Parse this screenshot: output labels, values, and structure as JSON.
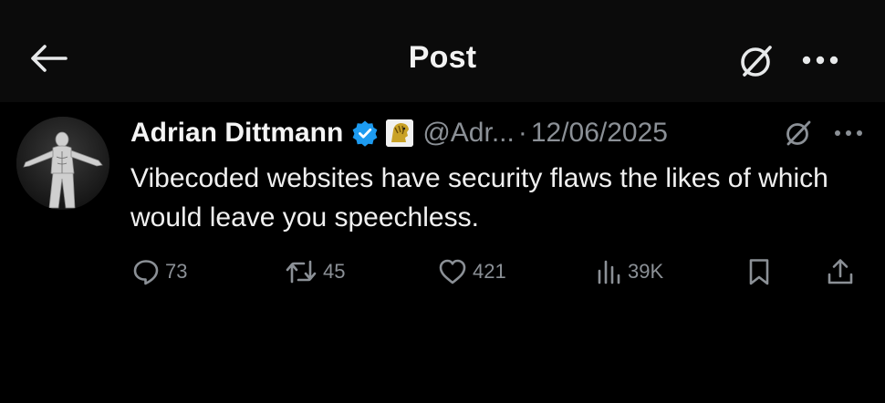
{
  "header": {
    "title": "Post",
    "back_icon": "arrow-left-icon",
    "grok_icon": "grok-icon",
    "more_icon": "more-horizontal-icon"
  },
  "tweet": {
    "display_name": "Adrian Dittmann",
    "handle": "@Adr...",
    "separator": "·",
    "timestamp": "12/06/2025",
    "verified_icon": "verified-badge-icon",
    "affiliate_icon": "lion-affiliate-badge-icon",
    "text": "Vibecoded websites have security flaws the likes of which would leave you speechless."
  },
  "actions": {
    "replies": "73",
    "reposts": "45",
    "likes": "421",
    "views": "39K",
    "bookmark_icon": "bookmark-icon",
    "share_icon": "share-icon"
  },
  "colors": {
    "background": "#000000",
    "header_background": "#0b0b0b",
    "text_primary": "#e7e9ea",
    "text_secondary": "#8b9096",
    "verified_blue": "#1d9bf0"
  }
}
